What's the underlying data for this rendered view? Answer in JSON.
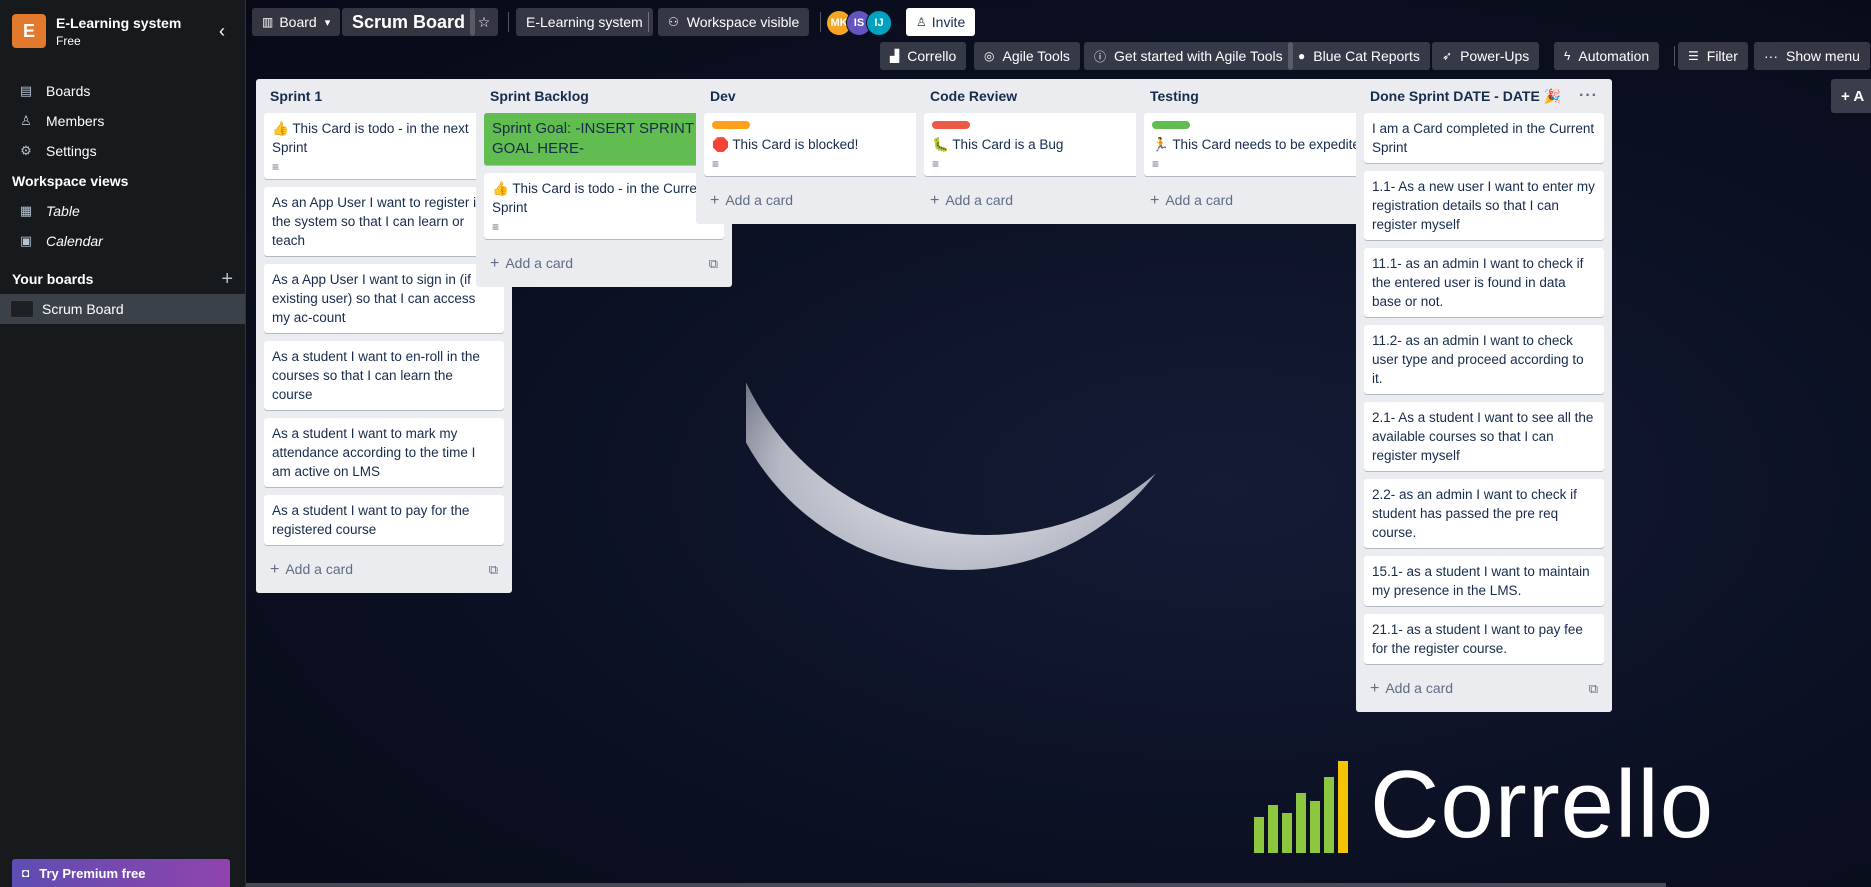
{
  "sidebar": {
    "workspace": {
      "initial": "E",
      "name": "E-Learning system",
      "plan": "Free"
    },
    "nav": [
      {
        "label": "Boards"
      },
      {
        "label": "Members"
      },
      {
        "label": "Settings"
      }
    ],
    "workspace_views_title": "Workspace views",
    "views": [
      {
        "label": "Table"
      },
      {
        "label": "Calendar"
      }
    ],
    "your_boards_title": "Your boards",
    "boards": [
      {
        "label": "Scrum Board"
      }
    ],
    "try_premium": "Try Premium free"
  },
  "header": {
    "view_switcher": "Board",
    "board_title": "Scrum Board",
    "workspace_button": "E-Learning system",
    "visibility_button": "Workspace visible",
    "invite_button": "Invite",
    "avatars": [
      {
        "initials": "MK",
        "color": "#f5a623"
      },
      {
        "initials": "IS",
        "color": "#6554c0"
      },
      {
        "initials": "IJ",
        "color": "#00a3bf"
      }
    ],
    "toolbar": {
      "corrello": "Corrello",
      "agile_tools": "Agile Tools",
      "get_started": "Get started with Agile Tools",
      "blue_cat": "Blue Cat Reports",
      "power_ups": "Power-Ups",
      "automation": "Automation",
      "filter": "Filter",
      "show_menu": "Show menu"
    }
  },
  "lists": {
    "sprint1": {
      "title": "Sprint 1",
      "cards": [
        "👍 This Card is todo - in the next Sprint",
        "As an App User I want to register in the system so that I can learn or teach",
        "As a App User I want to sign in (if existing user) so that I can access my ac-count",
        "As a student I want to en-roll in the courses so that I can learn the course",
        "As a student I want to mark my attendance according to the time I am active on LMS",
        "As a student I want to pay for the registered course"
      ],
      "add_card": "Add a card"
    },
    "backlog": {
      "title": "Sprint Backlog",
      "cards": [
        "Sprint Goal: -INSERT SPRINT GOAL HERE-",
        "👍 This Card is todo - in the Current Sprint"
      ],
      "add_card": "Add a card"
    },
    "dev": {
      "title": "Dev",
      "cards": [
        "🛑 This Card is blocked!"
      ],
      "label_color": "#ff9f1a",
      "add_card": "Add a card"
    },
    "review": {
      "title": "Code Review",
      "cards": [
        "🐛 This Card is a Bug"
      ],
      "label_color": "#eb5a46",
      "add_card": "Add a card"
    },
    "testing": {
      "title": "Testing",
      "cards": [
        "🏃 This Card needs to be expedited"
      ],
      "label_color": "#61bd4f",
      "add_card": "Add a card"
    },
    "done": {
      "title": "Done Sprint DATE - DATE 🎉",
      "cards": [
        "I am a Card completed in the Current Sprint",
        "1.1- As a new user I want to enter my registration details so that I can register myself",
        "11.1- as an admin I want to check if the entered user is found in data base or not.",
        "11.2- as an admin I want to check user type and proceed according to it.",
        "2.1- As a student I want to see all the available courses so that I can register myself",
        "2.2- as an admin I want to check if student has passed the pre req course.",
        "15.1- as a student I want to maintain my presence in the LMS.",
        "21.1- as a student I want to pay fee for the register course."
      ],
      "add_card": "Add a card"
    }
  },
  "add_list": "+ A",
  "background_logo": {
    "word": "Corrello"
  }
}
